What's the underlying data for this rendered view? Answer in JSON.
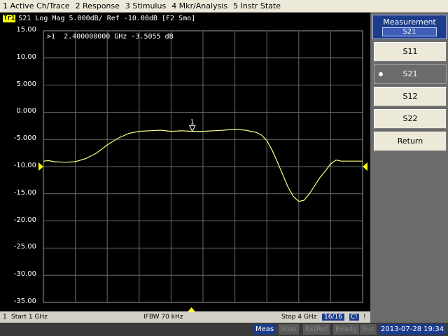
{
  "menu": [
    "1 Active Ch/Trace",
    "2 Response",
    "3 Stimulus",
    "4 Mkr/Analysis",
    "5 Instr State"
  ],
  "trace_header": {
    "badge": "Tr1",
    "text": "S21 Log Mag 5.000dB/ Ref -10.00dB [F2 Smo]"
  },
  "marker": {
    "label": "1",
    "readout_index": ">1",
    "readout": "2.400000000 GHz -3.5055 dB"
  },
  "y_ticks": [
    "15.00",
    "10.00",
    "5.000",
    "0.000",
    "-5.000",
    "-10.00",
    "-15.00",
    "-20.00",
    "-25.00",
    "-30.00",
    "-35.00"
  ],
  "chart_data": {
    "type": "line",
    "x_unit": "GHz",
    "xlim": [
      1,
      4
    ],
    "ylim": [
      -35,
      15
    ],
    "ref_level": -10,
    "grid": true,
    "series": [
      {
        "color": "#ffff80",
        "x": [
          1.0,
          1.05,
          1.1,
          1.2,
          1.3,
          1.4,
          1.5,
          1.6,
          1.7,
          1.8,
          1.9,
          2.0,
          2.1,
          2.2,
          2.3,
          2.4,
          2.5,
          2.6,
          2.7,
          2.8,
          2.9,
          3.0,
          3.05,
          3.1,
          3.15,
          3.2,
          3.25,
          3.3,
          3.35,
          3.4,
          3.45,
          3.5,
          3.55,
          3.6,
          3.65,
          3.7,
          3.75,
          3.8,
          3.85,
          3.9,
          3.95,
          4.0
        ],
        "y": [
          -9.0,
          -8.9,
          -9.1,
          -9.2,
          -9.1,
          -8.5,
          -7.5,
          -6.0,
          -4.8,
          -3.9,
          -3.5,
          -3.4,
          -3.3,
          -3.5,
          -3.4,
          -3.5,
          -3.5,
          -3.4,
          -3.3,
          -3.1,
          -3.3,
          -3.7,
          -4.2,
          -5.2,
          -7.0,
          -9.2,
          -11.5,
          -13.8,
          -15.5,
          -16.4,
          -16.2,
          -15.0,
          -13.5,
          -12.0,
          -10.8,
          -9.5,
          -8.8,
          -9.0,
          -9.0,
          -9.0,
          -9.0,
          -9.0
        ]
      }
    ],
    "marker": {
      "x": 2.4,
      "y": -3.5055
    }
  },
  "status": {
    "channel": "1",
    "start": "Start 1 GHz",
    "ifbw": "IFBW 70 kHz",
    "stop": "Stop 4 GHz",
    "count": "16/16",
    "cont": "C!",
    "excl": "!"
  },
  "bottom": {
    "meas": "Meas",
    "stop": "Stop",
    "extref": "ExtRef",
    "ready": "Ready",
    "svc": "Svc",
    "clock": "2013-07-28 19:34"
  },
  "softkeys": {
    "title": "Measurement",
    "value": "S21",
    "buttons": [
      "S11",
      "S21",
      "S12",
      "S22",
      "Return"
    ],
    "active": "S21"
  },
  "colors": {
    "trace": "#ffff80",
    "grid": "#6a6a6a",
    "ref_arrow": "#ffff00",
    "accent": "#1c3d8c"
  }
}
